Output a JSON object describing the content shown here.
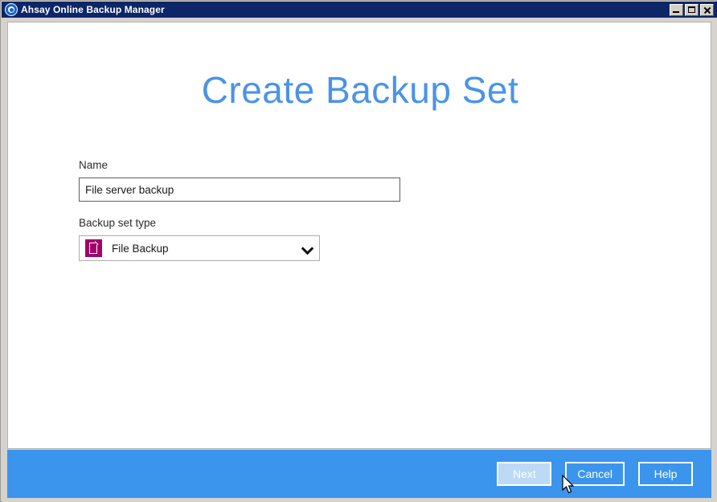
{
  "window": {
    "title": "Ahsay Online Backup Manager",
    "logo_icon": "ahsay-ring-logo",
    "controls": {
      "minimize": "minimize-icon",
      "maximize": "maximize-icon",
      "close": "close-icon"
    }
  },
  "page": {
    "title": "Create Backup Set",
    "title_color": "#4a93e8"
  },
  "form": {
    "name_label": "Name",
    "name_value": "File server backup",
    "name_placeholder": "",
    "type_label": "Backup set type",
    "type_value": "File Backup",
    "type_icon": "file-backup-icon",
    "type_icon_color": "#a4006b",
    "dropdown_icon": "chevron-down-icon"
  },
  "footer": {
    "background": "#3b95ec",
    "next_label": "Next",
    "cancel_label": "Cancel",
    "help_label": "Help"
  },
  "cursor": {
    "icon": "arrow-cursor"
  }
}
